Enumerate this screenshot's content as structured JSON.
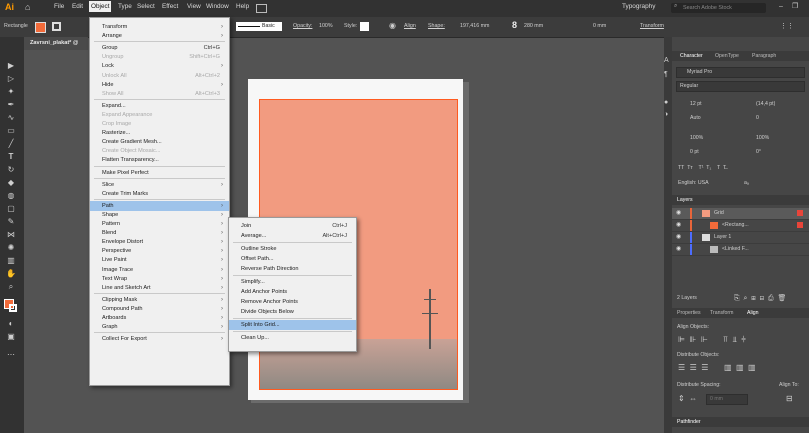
{
  "app": {
    "logo": "Ai"
  },
  "menubar": {
    "items": [
      "File",
      "Edit",
      "Object",
      "Type",
      "Select",
      "Effect",
      "View",
      "Window",
      "Help"
    ],
    "workspace": "Typography",
    "search_placeholder": "Search Adobe Stock"
  },
  "controlbar": {
    "selection": "Rectangle",
    "fill_color": "#f26b3a",
    "stroke_style": "Basic",
    "opacity_label": "Opacity:",
    "opacity_value": "100%",
    "style_label": "Style:",
    "align_label": "Align",
    "shape_label": "Shape:",
    "width_value": "197,416 mm",
    "height_value": "280 mm",
    "corner_value": "0 mm",
    "transform_label": "Transform"
  },
  "document": {
    "tab_title": "Zavrsni_plakat* @"
  },
  "object_menu": {
    "items": [
      {
        "label": "Transform",
        "shortcut": "",
        "submenu": true,
        "disabled": false
      },
      {
        "label": "Arrange",
        "shortcut": "",
        "submenu": true,
        "disabled": false
      },
      {
        "sep": true
      },
      {
        "label": "Group",
        "shortcut": "Ctrl+G",
        "submenu": false,
        "disabled": false
      },
      {
        "label": "Ungroup",
        "shortcut": "Shift+Ctrl+G",
        "submenu": false,
        "disabled": true
      },
      {
        "label": "Lock",
        "shortcut": "",
        "submenu": true,
        "disabled": false
      },
      {
        "label": "Unlock All",
        "shortcut": "Alt+Ctrl+2",
        "submenu": false,
        "disabled": true
      },
      {
        "label": "Hide",
        "shortcut": "",
        "submenu": true,
        "disabled": false
      },
      {
        "label": "Show All",
        "shortcut": "Alt+Ctrl+3",
        "submenu": false,
        "disabled": true
      },
      {
        "sep": true
      },
      {
        "label": "Expand...",
        "shortcut": "",
        "submenu": false,
        "disabled": false
      },
      {
        "label": "Expand Appearance",
        "shortcut": "",
        "submenu": false,
        "disabled": true
      },
      {
        "label": "Crop Image",
        "shortcut": "",
        "submenu": false,
        "disabled": true
      },
      {
        "label": "Rasterize...",
        "shortcut": "",
        "submenu": false,
        "disabled": false
      },
      {
        "label": "Create Gradient Mesh...",
        "shortcut": "",
        "submenu": false,
        "disabled": false
      },
      {
        "label": "Create Object Mosaic...",
        "shortcut": "",
        "submenu": false,
        "disabled": true
      },
      {
        "label": "Flatten Transparency...",
        "shortcut": "",
        "submenu": false,
        "disabled": false
      },
      {
        "sep": true
      },
      {
        "label": "Make Pixel Perfect",
        "shortcut": "",
        "submenu": false,
        "disabled": false
      },
      {
        "sep": true
      },
      {
        "label": "Slice",
        "shortcut": "",
        "submenu": true,
        "disabled": false
      },
      {
        "label": "Create Trim Marks",
        "shortcut": "",
        "submenu": false,
        "disabled": false
      },
      {
        "sep": true
      },
      {
        "label": "Path",
        "shortcut": "",
        "submenu": true,
        "disabled": false,
        "highlight": true
      },
      {
        "label": "Shape",
        "shortcut": "",
        "submenu": true,
        "disabled": false
      },
      {
        "label": "Pattern",
        "shortcut": "",
        "submenu": true,
        "disabled": false
      },
      {
        "label": "Blend",
        "shortcut": "",
        "submenu": true,
        "disabled": false
      },
      {
        "label": "Envelope Distort",
        "shortcut": "",
        "submenu": true,
        "disabled": false
      },
      {
        "label": "Perspective",
        "shortcut": "",
        "submenu": true,
        "disabled": false
      },
      {
        "label": "Live Paint",
        "shortcut": "",
        "submenu": true,
        "disabled": false
      },
      {
        "label": "Image Trace",
        "shortcut": "",
        "submenu": true,
        "disabled": false
      },
      {
        "label": "Text Wrap",
        "shortcut": "",
        "submenu": true,
        "disabled": false
      },
      {
        "label": "Line and Sketch Art",
        "shortcut": "",
        "submenu": true,
        "disabled": false
      },
      {
        "sep": true
      },
      {
        "label": "Clipping Mask",
        "shortcut": "",
        "submenu": true,
        "disabled": false
      },
      {
        "label": "Compound Path",
        "shortcut": "",
        "submenu": true,
        "disabled": false
      },
      {
        "label": "Artboards",
        "shortcut": "",
        "submenu": true,
        "disabled": false
      },
      {
        "label": "Graph",
        "shortcut": "",
        "submenu": true,
        "disabled": false
      },
      {
        "sep": true
      },
      {
        "label": "Collect For Export",
        "shortcut": "",
        "submenu": true,
        "disabled": false
      }
    ]
  },
  "path_submenu": {
    "items": [
      {
        "label": "Join",
        "shortcut": "Ctrl+J"
      },
      {
        "label": "Average...",
        "shortcut": "Alt+Ctrl+J"
      },
      {
        "sep": true
      },
      {
        "label": "Outline Stroke",
        "shortcut": ""
      },
      {
        "label": "Offset Path...",
        "shortcut": ""
      },
      {
        "label": "Reverse Path Direction",
        "shortcut": ""
      },
      {
        "sep": true
      },
      {
        "label": "Simplify...",
        "shortcut": ""
      },
      {
        "label": "Add Anchor Points",
        "shortcut": ""
      },
      {
        "label": "Remove Anchor Points",
        "shortcut": ""
      },
      {
        "label": "Divide Objects Below",
        "shortcut": ""
      },
      {
        "sep": true
      },
      {
        "label": "Split Into Grid...",
        "shortcut": "",
        "highlight": true
      },
      {
        "sep": true
      },
      {
        "label": "Clean Up...",
        "shortcut": ""
      }
    ]
  },
  "character_panel": {
    "tabs": [
      "Character",
      "OpenType",
      "Paragraph"
    ],
    "font_family": "Myriad Pro",
    "font_style": "Regular",
    "font_size": "12 pt",
    "leading": "(14,4 pt)",
    "kerning": "Auto",
    "tracking": "0",
    "vscale": "100%",
    "hscale": "100%",
    "baseline": "0 pt",
    "rotation": "0°",
    "language": "English: USA",
    "aa": "aₐ"
  },
  "layers_panel": {
    "title": "Layers",
    "rows": [
      {
        "name": "Grid",
        "color": "#e8653a",
        "indent": 0
      },
      {
        "name": "<Rectang...",
        "color": "#e8653a",
        "indent": 1
      },
      {
        "name": "Layer 1",
        "color": "#4c6cff",
        "indent": 0
      },
      {
        "name": "<Linked F...",
        "color": "#4c6cff",
        "indent": 1
      }
    ],
    "count": "2 Layers"
  },
  "align_panel": {
    "tabs": [
      "Properties",
      "Transform",
      "Align"
    ],
    "align_objects": "Align Objects:",
    "distribute_objects": "Distribute Objects:",
    "distribute_spacing": "Distribute Spacing:",
    "align_to": "Align To:",
    "spacing_value": "0 mm"
  },
  "pathfinder_panel": {
    "title": "Pathfinder"
  },
  "colors": {
    "orange": "#f29b80",
    "highlight": "#9ec3ea",
    "ui_dark": "#323232"
  }
}
